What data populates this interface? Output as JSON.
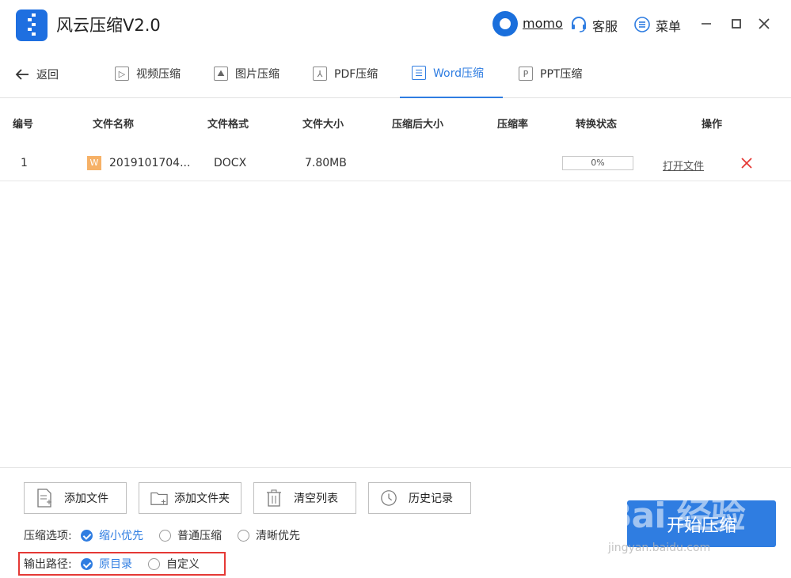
{
  "app": {
    "title": "风云压缩V2.0",
    "user_name": "momo",
    "service_label": "客服",
    "menu_label": "菜单"
  },
  "nav": {
    "back_label": "返回",
    "tabs": [
      {
        "label": "视频压缩",
        "icon": "video-icon"
      },
      {
        "label": "图片压缩",
        "icon": "image-icon"
      },
      {
        "label": "PDF压缩",
        "icon": "pdf-icon"
      },
      {
        "label": "Word压缩",
        "icon": "word-icon",
        "active": true
      },
      {
        "label": "PPT压缩",
        "icon": "ppt-icon"
      }
    ]
  },
  "table": {
    "headers": [
      "编号",
      "文件名称",
      "文件格式",
      "文件大小",
      "压缩后大小",
      "压缩率",
      "转换状态",
      "操作"
    ],
    "rows": [
      {
        "index": "1",
        "file_name": "2019101704...",
        "file_format": "DOCX",
        "file_size": "7.80MB",
        "compressed_size": "",
        "ratio": "",
        "progress_text": "0%",
        "progress": 0,
        "action_label": "打开文件"
      }
    ]
  },
  "toolbar": {
    "add_file": "添加文件",
    "add_folder": "添加文件夹",
    "clear_list": "清空列表",
    "history": "历史记录",
    "start": "开始压缩"
  },
  "options": {
    "compress_label": "压缩选项:",
    "compress_choices": [
      {
        "label": "缩小优先",
        "checked": true
      },
      {
        "label": "普通压缩",
        "checked": false
      },
      {
        "label": "清晰优先",
        "checked": false
      }
    ],
    "output_label": "输出路径:",
    "output_choices": [
      {
        "label": "原目录",
        "checked": true
      },
      {
        "label": "自定义",
        "checked": false
      }
    ]
  },
  "watermark": {
    "text": "Bai 经验",
    "sub": "jingyan.baidu.com"
  },
  "colors": {
    "accent": "#2f7de1",
    "highlight": "#e53935",
    "word_icon": "#f6b167"
  }
}
